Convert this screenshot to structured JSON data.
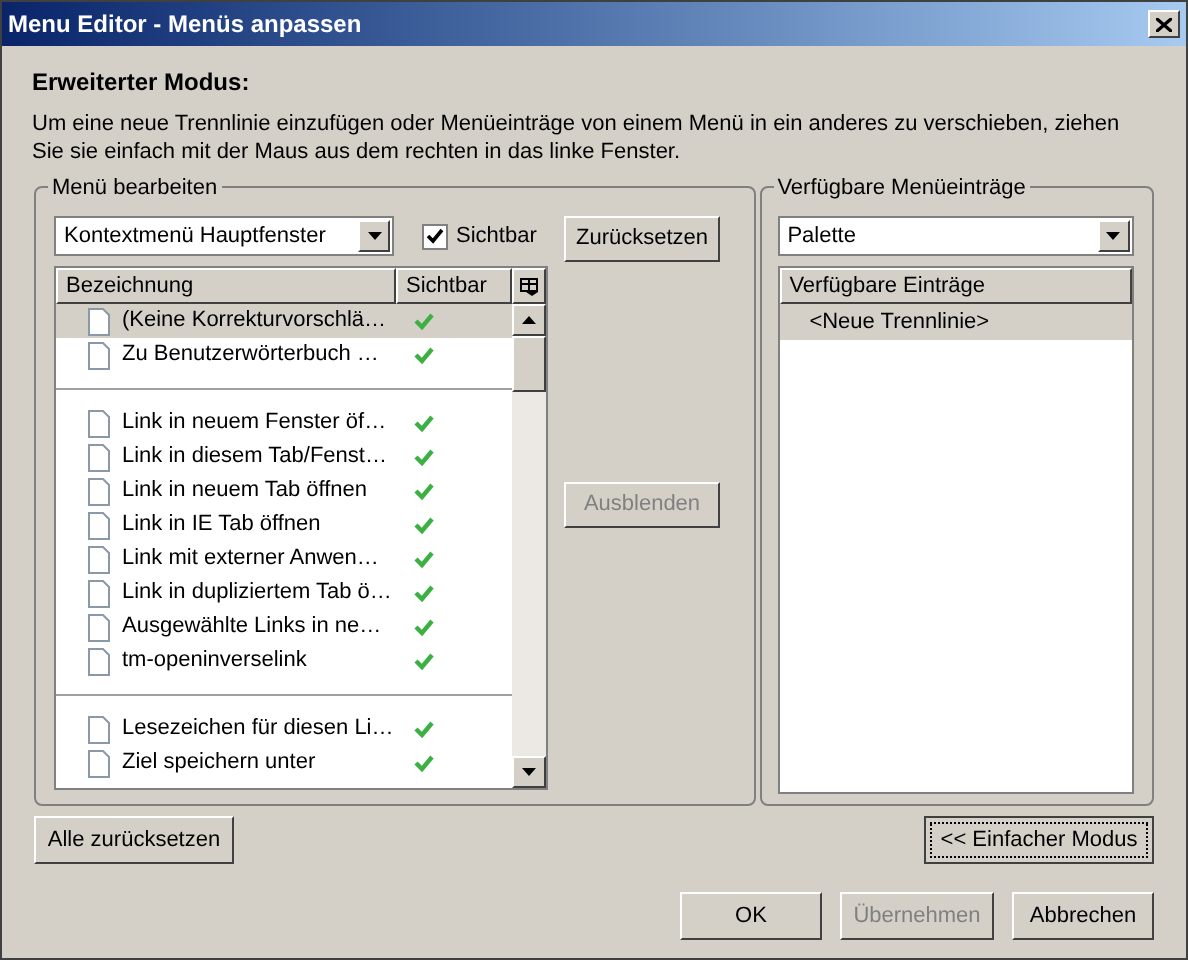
{
  "window": {
    "title": "Menu Editor - Menüs anpassen"
  },
  "intro": {
    "heading": "Erweiterter Modus:",
    "text": "Um eine neue Trennlinie einzufügen oder Menüeinträge von einem Menü in ein anderes zu verschieben, ziehen Sie sie einfach mit der Maus aus dem rechten in das linke Fenster."
  },
  "edit_group": {
    "title": "Menü bearbeiten",
    "menu_select": "Kontextmenü Hauptfenster",
    "visible_checkbox": {
      "label": "Sichtbar",
      "checked": true
    },
    "reset_button": {
      "label": "Zurücksetzen",
      "disabled": false
    },
    "hide_button": {
      "label": "Ausblenden",
      "disabled": true
    },
    "columns": [
      "Bezeichnung",
      "Sichtbar"
    ],
    "rows": [
      {
        "kind": "item",
        "label": "(Keine Korrekturvorschlä…",
        "visible": true,
        "selected": true
      },
      {
        "kind": "item",
        "label": "Zu Benutzerwörterbuch …",
        "visible": true,
        "selected": false
      },
      {
        "kind": "separator"
      },
      {
        "kind": "item",
        "label": "Link in neuem Fenster öf…",
        "visible": true,
        "selected": false
      },
      {
        "kind": "item",
        "label": "Link in diesem Tab/Fenst…",
        "visible": true,
        "selected": false
      },
      {
        "kind": "item",
        "label": "Link in neuem Tab öffnen",
        "visible": true,
        "selected": false
      },
      {
        "kind": "item",
        "label": "Link in IE Tab öffnen",
        "visible": true,
        "selected": false
      },
      {
        "kind": "item",
        "label": "Link mit externer Anwen…",
        "visible": true,
        "selected": false
      },
      {
        "kind": "item",
        "label": "Link in dupliziertem Tab ö…",
        "visible": true,
        "selected": false
      },
      {
        "kind": "item",
        "label": "Ausgewählte Links in ne…",
        "visible": true,
        "selected": false
      },
      {
        "kind": "item",
        "label": "tm-openinverselink",
        "visible": true,
        "selected": false
      },
      {
        "kind": "separator"
      },
      {
        "kind": "item",
        "label": "Lesezeichen für diesen Li…",
        "visible": true,
        "selected": false
      },
      {
        "kind": "item",
        "label": "Ziel speichern unter",
        "visible": true,
        "selected": false
      }
    ]
  },
  "available_group": {
    "title": "Verfügbare Menüeinträge",
    "palette_select": "Palette",
    "column": "Verfügbare Einträge",
    "items": [
      {
        "label": "<Neue Trennlinie>",
        "selected": true
      }
    ]
  },
  "buttons": {
    "reset_all": {
      "label": "Alle zurücksetzen",
      "disabled": false
    },
    "simple_mode": {
      "label": "<< Einfacher Modus",
      "disabled": false
    },
    "ok": {
      "label": "OK",
      "disabled": false
    },
    "apply": {
      "label": "Übernehmen",
      "disabled": true
    },
    "cancel": {
      "label": "Abbrechen",
      "disabled": false
    }
  }
}
